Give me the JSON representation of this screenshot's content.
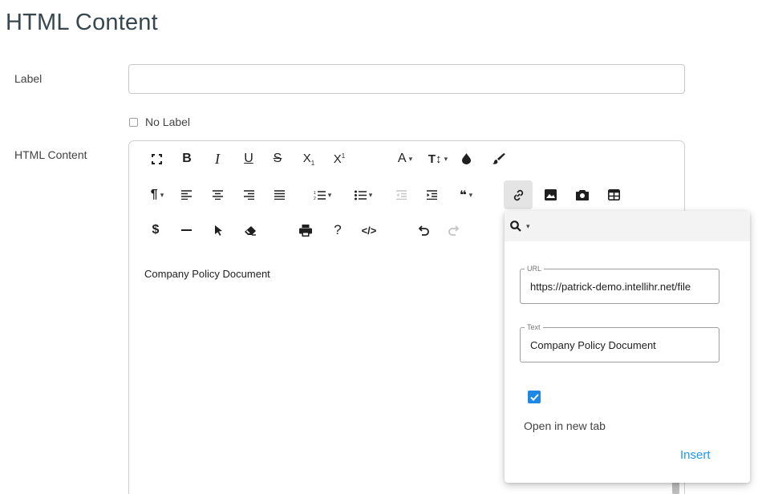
{
  "page": {
    "title": "HTML Content"
  },
  "label_field": {
    "label": "Label",
    "value": ""
  },
  "no_label": {
    "label": "No Label",
    "checked": false
  },
  "html_field": {
    "label": "HTML Content"
  },
  "toolbar": {
    "row1": [
      "fullscreen-icon",
      "bold-icon",
      "italic-icon",
      "underline-icon",
      "strikethrough-icon",
      "subscript-icon",
      "superscript-icon",
      "font-family-icon",
      "font-size-icon",
      "text-color-icon",
      "background-color-icon"
    ],
    "row2": [
      "paragraph-format-icon",
      "align-left-icon",
      "align-center-icon",
      "align-right-icon",
      "align-justify-icon",
      "ordered-list-icon",
      "unordered-list-icon",
      "outdent-icon",
      "indent-icon",
      "quote-icon",
      "insert-link-icon",
      "insert-image-icon",
      "insert-video-icon",
      "insert-table-icon"
    ],
    "row3": [
      "insert-dollar-icon",
      "horizontal-line-icon",
      "select-all-icon",
      "clear-formatting-icon",
      "print-icon",
      "help-icon",
      "code-view-icon",
      "undo-icon",
      "redo-icon"
    ]
  },
  "editor": {
    "content": "Company Policy Document"
  },
  "link_popup": {
    "url_label": "URL",
    "url_value": "https://patrick-demo.intellihr.net/file",
    "text_label": "Text",
    "text_value": "Company Policy Document",
    "open_new_tab_label": "Open in new tab",
    "open_new_tab_checked": true,
    "insert_label": "Insert"
  },
  "colors": {
    "accent": "#2196f3",
    "checkbox": "#1e88e5",
    "title": "#37474f"
  }
}
